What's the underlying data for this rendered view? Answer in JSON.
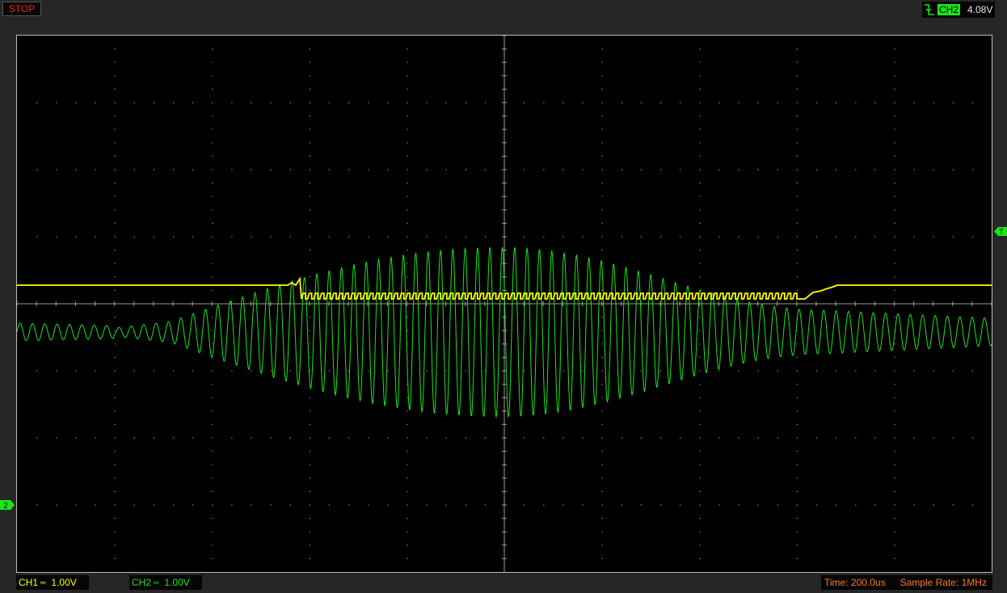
{
  "status": {
    "run_state": "STOP"
  },
  "trigger": {
    "icon": "falling-edge-icon",
    "channel": "CH2",
    "level": "4.08V"
  },
  "markers": {
    "trigger_level": "T",
    "ch2_ground": "2"
  },
  "channels": [
    {
      "name": "CH1",
      "coupling_icon": "dc-coupling-icon",
      "scale": "1.00V",
      "color": "#ffff00"
    },
    {
      "name": "CH2",
      "coupling_icon": "dc-coupling-icon",
      "scale": "1.00V",
      "color": "#19e619"
    }
  ],
  "timebase": {
    "label": "Time: 200.0us"
  },
  "sample_rate": {
    "label": "Sample Rate: 1MHz"
  },
  "display": {
    "grid": true,
    "divisions_x": 10,
    "divisions_y": 8,
    "accent": "#ff7a1a"
  },
  "chart_data": {
    "type": "line",
    "series": [
      {
        "name": "CH1",
        "values": [
          0.0
        ]
      },
      {
        "name": "CH2",
        "values": [
          0.0
        ]
      }
    ]
  }
}
